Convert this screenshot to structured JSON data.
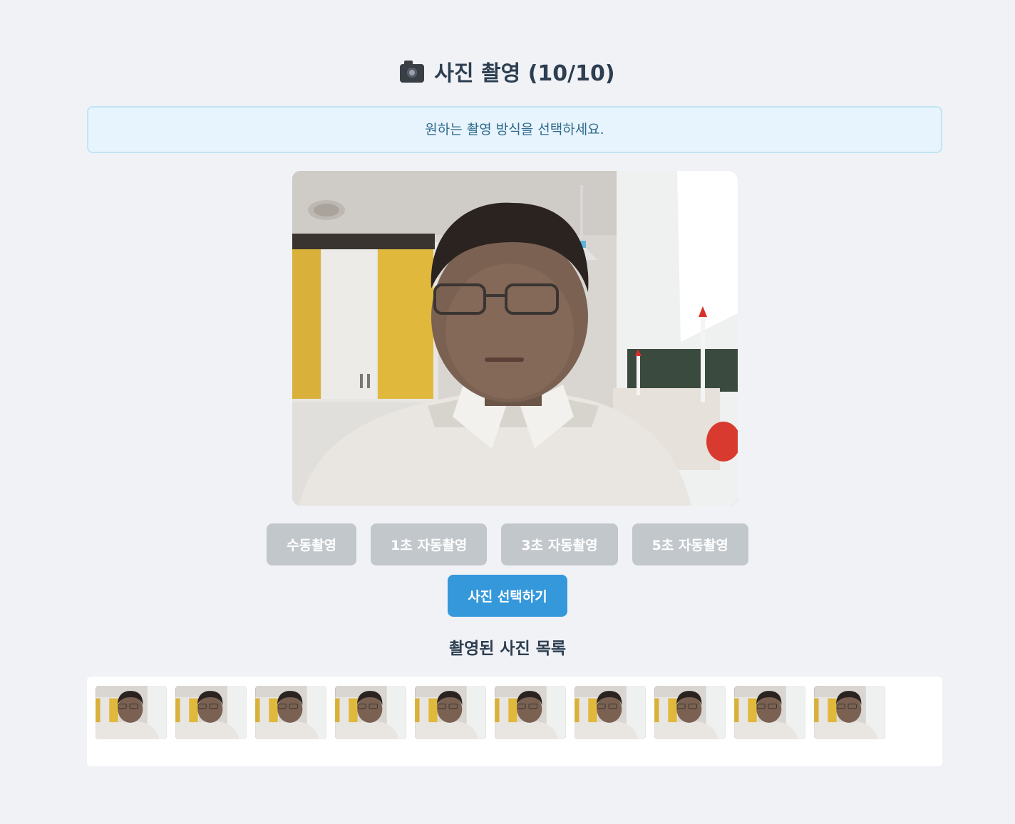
{
  "page": {
    "title": "사진 촬영 (10/10)",
    "title_icon": "camera-icon",
    "info_message": "원하는 촬영 방식을 선택하세요."
  },
  "capture_buttons": [
    {
      "label": "수동촬영",
      "enabled": false
    },
    {
      "label": "1초 자동촬영",
      "enabled": false
    },
    {
      "label": "3초 자동촬영",
      "enabled": false
    },
    {
      "label": "5초 자동촬영",
      "enabled": false
    }
  ],
  "select_button": {
    "label": "사진 선택하기"
  },
  "gallery": {
    "title": "촬영된 사진 목록",
    "thumbnail_count": 10
  },
  "colors": {
    "background": "#f1f2f6",
    "accent": "#3498db",
    "disabled_button": "#c2c7cc",
    "info_bg": "#e8f4fd",
    "info_border": "#bfe6f2"
  }
}
